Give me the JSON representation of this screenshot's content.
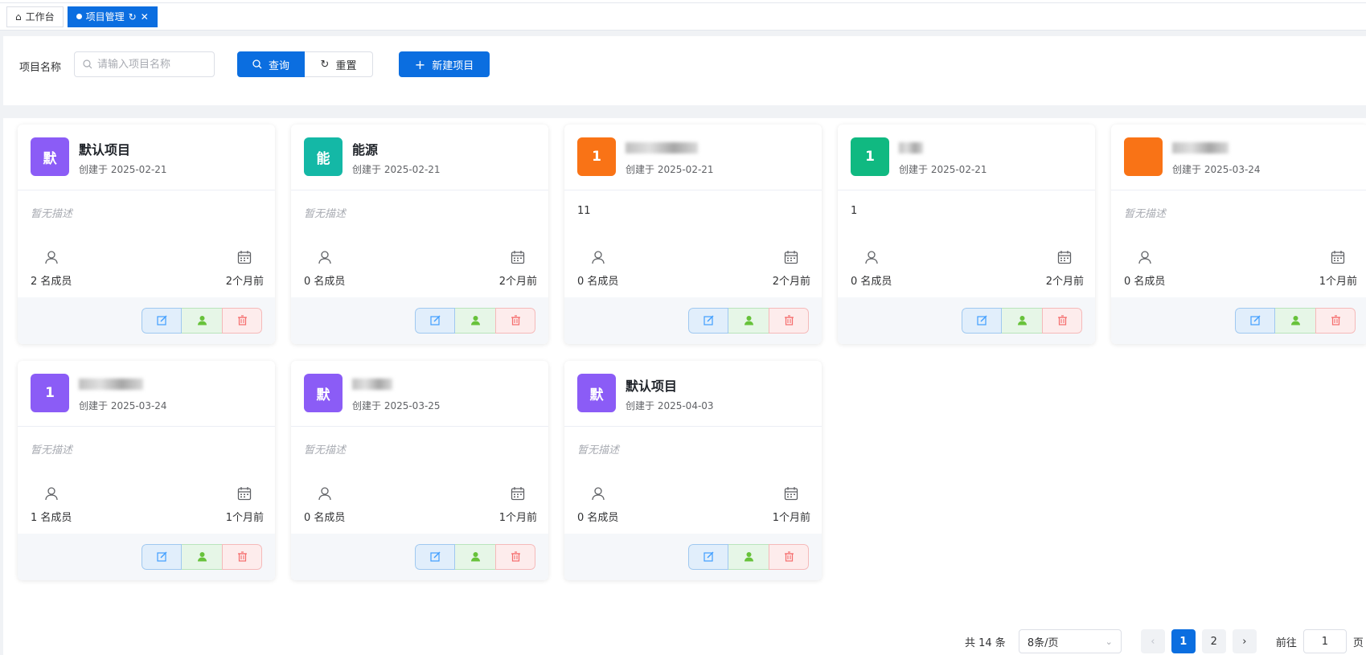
{
  "tabs": [
    {
      "label": "工作台",
      "icon": "home-icon"
    },
    {
      "label": "项目管理",
      "icon": "dot-icon"
    }
  ],
  "search": {
    "label": "项目名称",
    "placeholder": "请输入项目名称",
    "query_label": "查询",
    "reset_label": "重置",
    "new_label": "新建项目"
  },
  "cards": [
    {
      "avatar": "默",
      "title": "默认项目",
      "title_blurred": false,
      "date": "创建于 2025-02-21",
      "desc": "暂无描述",
      "desc_empty": true,
      "members": "2 名成员",
      "time": "2个月前",
      "color": "#8b5cf6"
    },
    {
      "avatar": "能",
      "title": "能源",
      "title_blurred": false,
      "date": "创建于 2025-02-21",
      "desc": "暂无描述",
      "desc_empty": true,
      "members": "0 名成员",
      "time": "2个月前",
      "color": "#14b8a6"
    },
    {
      "avatar": "1",
      "title": "",
      "title_blurred": true,
      "date": "创建于 2025-02-21",
      "desc": "11",
      "desc_empty": false,
      "members": "0 名成员",
      "time": "2个月前",
      "color": "#f97316"
    },
    {
      "avatar": "1",
      "title": "",
      "title_blurred": true,
      "date": "创建于 2025-02-21",
      "desc": "1",
      "desc_empty": false,
      "members": "0 名成员",
      "time": "2个月前",
      "color": "#10b981"
    },
    {
      "avatar": "",
      "title": "",
      "title_blurred": true,
      "date": "创建于 2025-03-24",
      "desc": "暂无描述",
      "desc_empty": true,
      "members": "0 名成员",
      "time": "1个月前",
      "color": "#f97316"
    },
    {
      "avatar": "1",
      "title": "",
      "title_blurred": true,
      "date": "创建于 2025-03-24",
      "desc": "暂无描述",
      "desc_empty": true,
      "members": "1 名成员",
      "time": "1个月前",
      "color": "#8b5cf6"
    },
    {
      "avatar": "默",
      "title": "",
      "title_blurred": true,
      "date": "创建于 2025-03-25",
      "desc": "暂无描述",
      "desc_empty": true,
      "members": "0 名成员",
      "time": "1个月前",
      "color": "#8b5cf6"
    },
    {
      "avatar": "默",
      "title": "默认项目",
      "title_blurred": false,
      "date": "创建于 2025-04-03",
      "desc": "暂无描述",
      "desc_empty": true,
      "members": "0 名成员",
      "time": "1个月前",
      "color": "#8b5cf6"
    }
  ],
  "pagination": {
    "total": "共 14 条",
    "page_size": "8条/页",
    "pages": [
      "1",
      "2"
    ],
    "current": "1",
    "goto_label": "前往",
    "goto_value": "1",
    "page_suffix": "页"
  },
  "colors": {
    "primary": "#0b6ee0",
    "edit": "#409eff",
    "member": "#67c23a",
    "delete": "#f56c6c"
  }
}
